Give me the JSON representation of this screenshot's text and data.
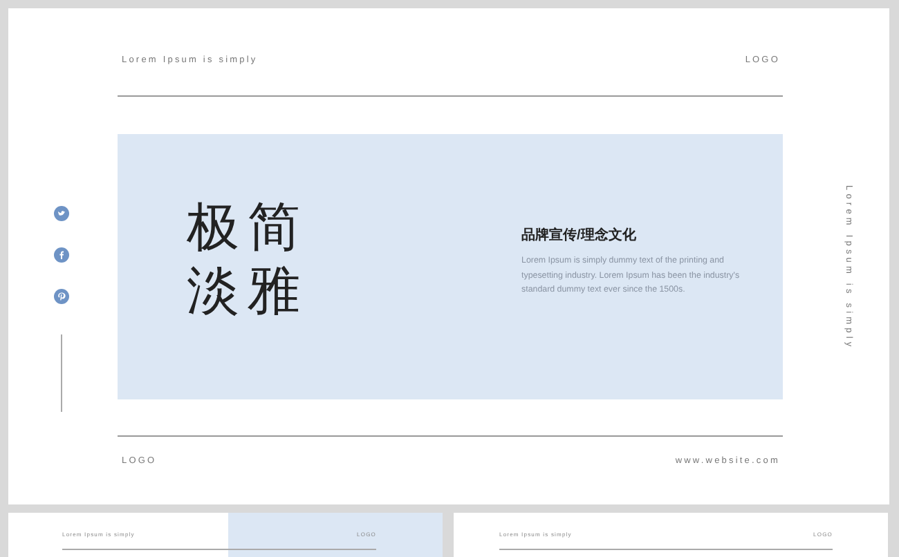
{
  "main_slide": {
    "header_text": "Lorem Ipsum is simply",
    "logo": "LOGO",
    "title_lines": [
      "极简",
      "淡雅"
    ],
    "subtitle": "品牌宣传/理念文化",
    "body": "Lorem Ipsum is simply dummy text of the printing and typesetting industry. Lorem Ipsum has been the industry's standard dummy text ever since the 1500s.",
    "side_text": "Lorem Ipsum is simply",
    "footer_logo": "LOGO",
    "website": "www.website.com"
  },
  "thumbnails": [
    {
      "kind": "accent",
      "header_text": "Lorem Ipsum is simply",
      "logo": "LOGO"
    },
    {
      "kind": "plain",
      "header_text": "Lorem Ipsum is simply",
      "logo": "LOGO"
    }
  ]
}
